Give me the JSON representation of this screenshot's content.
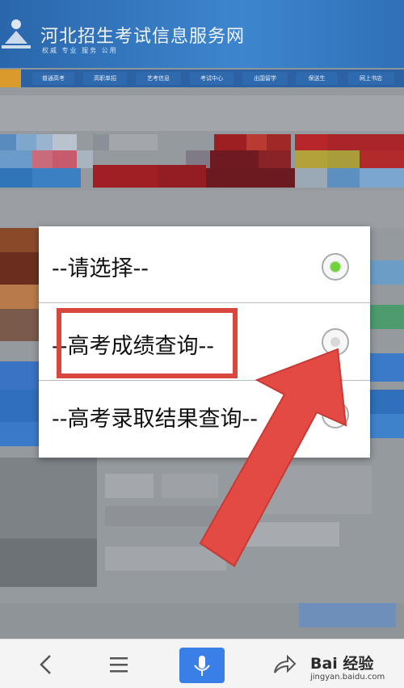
{
  "header": {
    "title": "河北招生考试信息服务网",
    "slogan": "权威  专业  服务  公用"
  },
  "nav": {
    "items": [
      "普通高考",
      "高职单招",
      "艺考信息",
      "考试中心",
      "出国留学",
      "保送生",
      "网上书店"
    ]
  },
  "dialog": {
    "options": [
      {
        "label": "--请选择--",
        "checked": true
      },
      {
        "label": "--高考成绩查询--",
        "checked": false
      },
      {
        "label": "--高考录取结果查询--",
        "checked": false
      }
    ]
  },
  "watermark": {
    "main": "Bai 经验",
    "sub": "jingyan.baidu.com"
  },
  "colors": {
    "header": "#2f70b8",
    "annotation": "#d9463d",
    "radio_checked": "#6fd33c",
    "mic_button": "#3a7ee8"
  },
  "icons": {
    "back": "chevron-left-icon",
    "menu": "hamburger-menu-icon",
    "mic": "microphone-icon",
    "share": "share-arrow-icon"
  }
}
